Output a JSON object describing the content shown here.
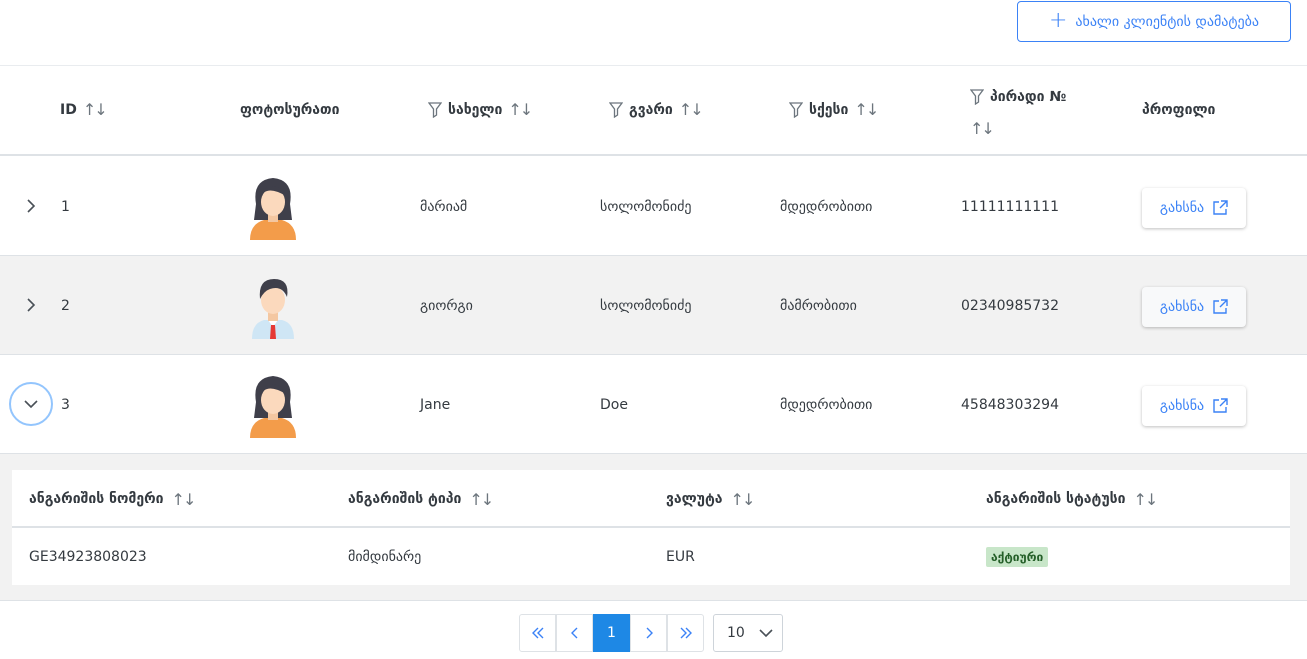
{
  "toolbar": {
    "add_client_label": "ახალი კლიენტის დამატება"
  },
  "table": {
    "columns": {
      "id": "ID",
      "photo": "ფოტოსურათი",
      "first_name": "სახელი",
      "last_name": "გვარი",
      "sex": "სქესი",
      "personal_no": "პირადი №",
      "profile": "პროფილი"
    },
    "rows": [
      {
        "id": "1",
        "first_name": "მარიამ",
        "last_name": "სოლომონიძე",
        "sex": "მდედრობითი",
        "personal_no": "11111111111",
        "open_label": "გახსნა",
        "avatar": "female-avatar-icon"
      },
      {
        "id": "2",
        "first_name": "გიორგი",
        "last_name": "სოლომონიძე",
        "sex": "მამრობითი",
        "personal_no": "02340985732",
        "open_label": "გახსნა",
        "avatar": "male-avatar-icon"
      },
      {
        "id": "3",
        "first_name": "Jane",
        "last_name": "Doe",
        "sex": "მდედრობითი",
        "personal_no": "45848303294",
        "open_label": "გახსნა",
        "avatar": "female-avatar-icon"
      }
    ]
  },
  "accounts": {
    "columns": {
      "account_number": "ანგარიშის ნომერი",
      "account_type": "ანგარიშის ტიპი",
      "currency": "ვალუტა",
      "status": "ანგარიშის სტატუსი"
    },
    "rows": [
      {
        "account_number": "GE34923808023",
        "account_type": "მიმდინარე",
        "currency": "EUR",
        "status": "აქტიური"
      }
    ]
  },
  "paginator": {
    "current_page": "1",
    "rows_per_page": "10"
  },
  "colors": {
    "primary": "#3b82f6",
    "active_page": "#1e88e5",
    "badge_bg": "#c8e6c9",
    "badge_text": "#256029"
  }
}
